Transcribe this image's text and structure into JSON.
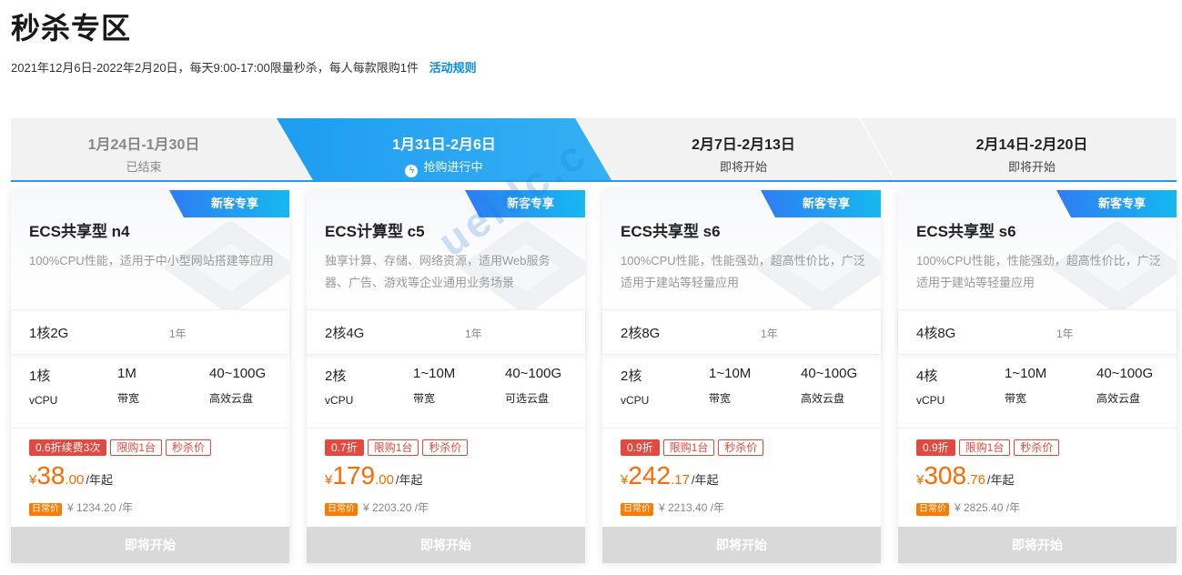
{
  "header": {
    "title": "秒杀专区",
    "subtitle": "2021年12月6日-2022年2月20日，每天9:00-17:00限量秒杀，每人每款限购1件",
    "rules_link": "活动规则"
  },
  "tabs": [
    {
      "date": "1月24日-1月30日",
      "status": "已结束"
    },
    {
      "date": "1月31日-2月6日",
      "status": "抢购进行中"
    },
    {
      "date": "2月7日-2月13日",
      "status": "即将开始"
    },
    {
      "date": "2月14日-2月20日",
      "status": "即将开始"
    }
  ],
  "colors": {
    "accent": "#1e9cf0",
    "price": "#ff6a00",
    "tag": "#e5483f",
    "badge_from": "#2f7cf3",
    "badge_to": "#16b9f0"
  },
  "watermark": "ueidc.c",
  "cards": [
    {
      "badge": "新客专享",
      "name": "ECS共享型 n4",
      "desc": "100%CPU性能，适用于中小型网站搭建等应用",
      "config": "1核2G",
      "term": "1年",
      "specs": [
        {
          "value": "1核",
          "label": "vCPU"
        },
        {
          "value": "1M",
          "label": "带宽"
        },
        {
          "value": "40~100G",
          "label": "高效云盘"
        }
      ],
      "tags": [
        "0.6折续费3次",
        "限购1台",
        "秒杀价"
      ],
      "price": {
        "currency": "¥",
        "int": "38",
        "dec": ".00",
        "unit": "/年起"
      },
      "regular_label": "日常价",
      "regular_price": "¥ 1234.20 /年",
      "action": "即将开始"
    },
    {
      "badge": "新客专享",
      "name": "ECS计算型 c5",
      "desc": "独享计算、存储、网络资源，适用Web服务器、广告、游戏等企业通用业务场景",
      "config": "2核4G",
      "term": "1年",
      "specs": [
        {
          "value": "2核",
          "label": "vCPU"
        },
        {
          "value": "1~10M",
          "label": "带宽"
        },
        {
          "value": "40~100G",
          "label": "可选云盘"
        }
      ],
      "tags": [
        "0.7折",
        "限购1台",
        "秒杀价"
      ],
      "price": {
        "currency": "¥",
        "int": "179",
        "dec": ".00",
        "unit": "/年起"
      },
      "regular_label": "日常价",
      "regular_price": "¥ 2203.20 /年",
      "action": "即将开始"
    },
    {
      "badge": "新客专享",
      "name": "ECS共享型 s6",
      "desc": "100%CPU性能，性能强劲，超高性价比，广泛适用于建站等轻量应用",
      "config": "2核8G",
      "term": "1年",
      "specs": [
        {
          "value": "2核",
          "label": "vCPU"
        },
        {
          "value": "1~10M",
          "label": "带宽"
        },
        {
          "value": "40~100G",
          "label": "高效云盘"
        }
      ],
      "tags": [
        "0.9折",
        "限购1台",
        "秒杀价"
      ],
      "price": {
        "currency": "¥",
        "int": "242",
        "dec": ".17",
        "unit": "/年起"
      },
      "regular_label": "日常价",
      "regular_price": "¥ 2213.40 /年",
      "action": "即将开始"
    },
    {
      "badge": "新客专享",
      "name": "ECS共享型 s6",
      "desc": "100%CPU性能，性能强劲，超高性价比，广泛适用于建站等轻量应用",
      "config": "4核8G",
      "term": "1年",
      "specs": [
        {
          "value": "4核",
          "label": "vCPU"
        },
        {
          "value": "1~10M",
          "label": "带宽"
        },
        {
          "value": "40~100G",
          "label": "高效云盘"
        }
      ],
      "tags": [
        "0.9折",
        "限购1台",
        "秒杀价"
      ],
      "price": {
        "currency": "¥",
        "int": "308",
        "dec": ".76",
        "unit": "/年起"
      },
      "regular_label": "日常价",
      "regular_price": "¥ 2825.40 /年",
      "action": "即将开始"
    }
  ]
}
